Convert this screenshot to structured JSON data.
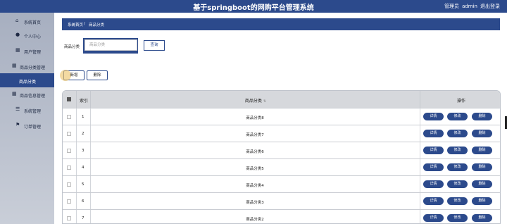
{
  "header": {
    "title": "基于springboot的网购平台管理系统",
    "role_label": "管理员",
    "username": "admin",
    "logout_label": "退出登录"
  },
  "sidebar": {
    "items": [
      {
        "label": "系统首页",
        "icon": "home-icon"
      },
      {
        "label": "个人中心",
        "icon": "person-icon"
      },
      {
        "label": "用户管理",
        "icon": "grid-icon"
      },
      {
        "label": "商品分类管理",
        "icon": "grid-icon"
      },
      {
        "label": "商品分类",
        "icon": ""
      },
      {
        "label": "商品信息管理",
        "icon": "grid-icon"
      },
      {
        "label": "系统管理",
        "icon": "list-icon"
      },
      {
        "label": "订单管理",
        "icon": "flag-icon"
      }
    ]
  },
  "breadcrumb": {
    "home": "系统首页",
    "separator": "/",
    "current": "商品分类"
  },
  "search": {
    "label": "商品分类",
    "placeholder": "商品分类",
    "button_label": "查询"
  },
  "actions": {
    "add_label": "新增",
    "delete_label": "删除"
  },
  "table": {
    "headers": {
      "index": "索引",
      "name": "商品分类",
      "operation": "操作"
    },
    "op_labels": {
      "detail": "详情",
      "edit": "修改",
      "delete": "删除"
    },
    "rows": [
      {
        "index": "1",
        "name": "商品分类8"
      },
      {
        "index": "2",
        "name": "商品分类7"
      },
      {
        "index": "3",
        "name": "商品分类6"
      },
      {
        "index": "4",
        "name": "商品分类5"
      },
      {
        "index": "5",
        "name": "商品分类4"
      },
      {
        "index": "6",
        "name": "商品分类3"
      },
      {
        "index": "7",
        "name": "商品分类2"
      }
    ]
  },
  "colors": {
    "primary": "#2c4a8c",
    "sidebar_bg": "#b4bbc9",
    "table_header_bg": "#d6d8dc"
  }
}
